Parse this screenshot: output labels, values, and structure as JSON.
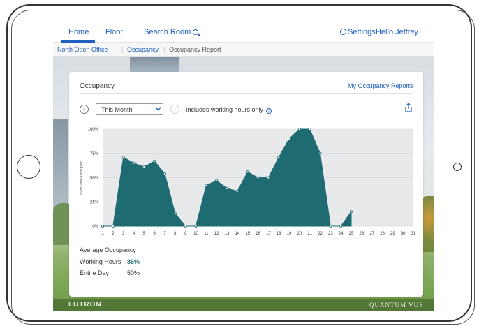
{
  "nav": {
    "home": "Home",
    "floor": "Floor",
    "search_room": "Search Room",
    "settings": "Settings",
    "hello": "Hello Jeffrey"
  },
  "breadcrumb": {
    "item1": "North Open Office",
    "sep": "|",
    "item2": "Occupancy",
    "item3": "Occupancy Report"
  },
  "card": {
    "title": "Occupancy",
    "reports_link": "My Occupancy Reports",
    "range": "This Month",
    "hours_note": "Includes working hours only",
    "info_glyph": "i"
  },
  "summary": {
    "title": "Average Occupancy",
    "working_hours_label": "Working Hours",
    "working_hours_value": "86%",
    "entire_day_label": "Entire Day",
    "entire_day_value": "50%"
  },
  "branding": {
    "left_logo": "LUTRON",
    "right_logo": "QUANTUM VUE"
  },
  "colors": {
    "accent": "#1f5fbf",
    "series": "#1e6b72",
    "plot_bg": "#e8e9ea"
  },
  "icons": [
    "search-icon",
    "gear-icon",
    "chevron-down-icon",
    "info-icon",
    "share-icon",
    "prev-arrow-icon",
    "next-arrow-icon"
  ],
  "chart_data": {
    "type": "area",
    "ylabel": "% of Time Occupied",
    "ylim": [
      0,
      100
    ],
    "yticks": [
      "0%",
      "25%",
      "50%",
      "75%",
      "100%"
    ],
    "x": [
      1,
      2,
      3,
      4,
      5,
      6,
      7,
      8,
      9,
      10,
      11,
      12,
      13,
      14,
      15,
      16,
      17,
      18,
      19,
      20,
      21,
      22,
      23,
      24,
      25,
      26,
      27,
      28,
      29,
      30,
      31
    ],
    "series": [
      {
        "values": [
          0,
          0,
          71,
          65,
          61,
          67,
          54,
          13,
          0,
          0,
          42,
          47,
          39,
          36,
          56,
          50,
          50,
          71,
          90,
          100,
          100,
          75,
          0,
          0,
          15,
          null,
          null,
          null,
          null,
          null,
          null
        ]
      }
    ]
  }
}
